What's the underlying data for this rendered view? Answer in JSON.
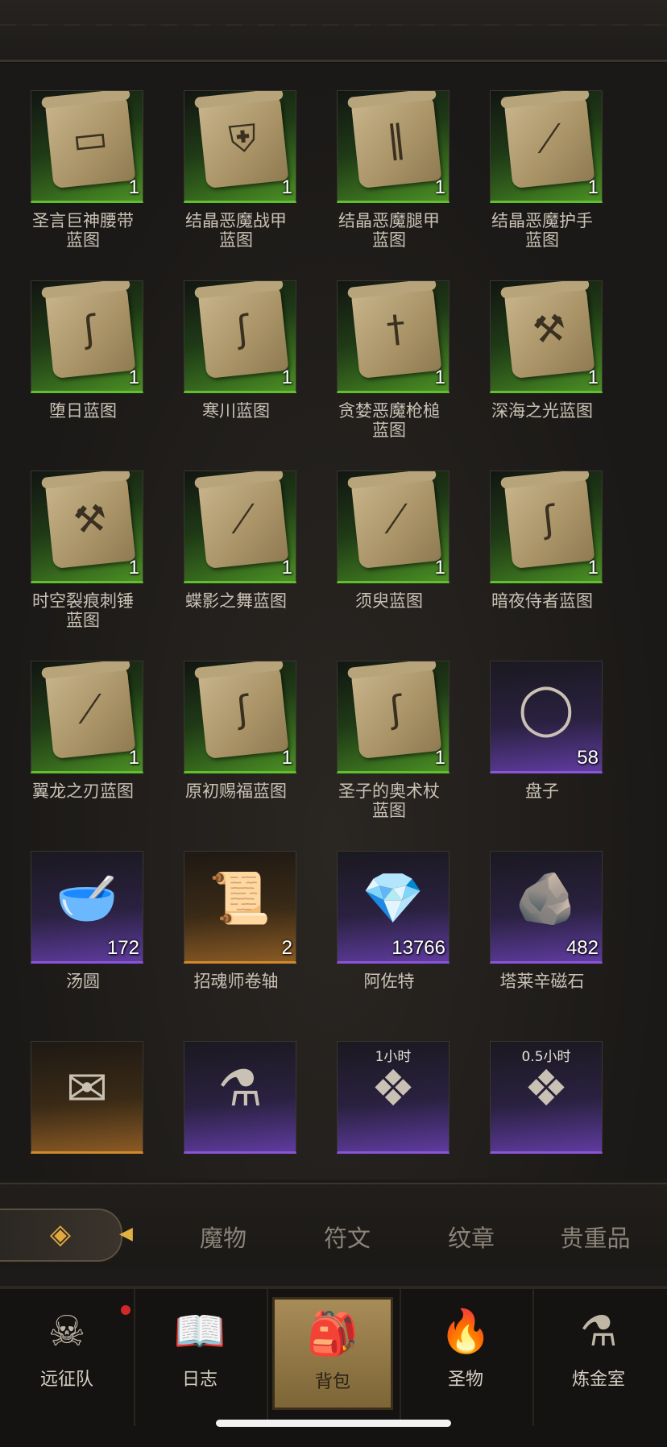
{
  "items": [
    {
      "name": "圣言巨神腰带\n蓝图",
      "count": "1",
      "rarity": "green",
      "icon": "blueprint-belt-icon",
      "glyph": "▭"
    },
    {
      "name": "结晶恶魔战甲\n蓝图",
      "count": "1",
      "rarity": "green",
      "icon": "blueprint-armor-icon",
      "glyph": "⛨"
    },
    {
      "name": "结晶恶魔腿甲\n蓝图",
      "count": "1",
      "rarity": "green",
      "icon": "blueprint-legs-icon",
      "glyph": "‖"
    },
    {
      "name": "结晶恶魔护手\n蓝图",
      "count": "1",
      "rarity": "green",
      "icon": "blueprint-gauntlet-icon",
      "glyph": "⟋"
    },
    {
      "name": "堕日蓝图",
      "count": "1",
      "rarity": "green",
      "icon": "blueprint-staff-icon",
      "glyph": "ʃ"
    },
    {
      "name": "寒川蓝图",
      "count": "1",
      "rarity": "green",
      "icon": "blueprint-staff-icon",
      "glyph": "ʃ"
    },
    {
      "name": "贪婪恶魔枪槌\n蓝图",
      "count": "1",
      "rarity": "green",
      "icon": "blueprint-spear-icon",
      "glyph": "†"
    },
    {
      "name": "深海之光蓝图",
      "count": "1",
      "rarity": "green",
      "icon": "blueprint-hammer-icon",
      "glyph": "⚒"
    },
    {
      "name": "时空裂痕刺锤\n蓝图",
      "count": "1",
      "rarity": "green",
      "icon": "blueprint-hammer-icon",
      "glyph": "⚒"
    },
    {
      "name": "蝶影之舞蓝图",
      "count": "1",
      "rarity": "green",
      "icon": "blueprint-dagger-icon",
      "glyph": "⟋"
    },
    {
      "name": "须臾蓝图",
      "count": "1",
      "rarity": "green",
      "icon": "blueprint-sword-icon",
      "glyph": "⟋"
    },
    {
      "name": "暗夜侍者蓝图",
      "count": "1",
      "rarity": "green",
      "icon": "blueprint-staff-icon",
      "glyph": "ʃ"
    },
    {
      "name": "翼龙之刃蓝图",
      "count": "1",
      "rarity": "green",
      "icon": "blueprint-sword-icon",
      "glyph": "⟋"
    },
    {
      "name": "原初赐福蓝图",
      "count": "1",
      "rarity": "green",
      "icon": "blueprint-staff-icon",
      "glyph": "ʃ"
    },
    {
      "name": "圣子的奥术杖\n蓝图",
      "count": "1",
      "rarity": "green",
      "icon": "blueprint-staff-icon",
      "glyph": "ʃ"
    },
    {
      "name": "盘子",
      "count": "58",
      "rarity": "purple",
      "icon": "plate-icon",
      "glyph": "◯"
    },
    {
      "name": "汤圆",
      "count": "172",
      "rarity": "purple",
      "icon": "rice-dumplings-icon",
      "glyph": "🥣"
    },
    {
      "name": "招魂师卷轴",
      "count": "2",
      "rarity": "orange",
      "icon": "necromancer-scroll-icon",
      "glyph": "📜"
    },
    {
      "name": "阿佐特",
      "count": "13766",
      "rarity": "purple",
      "icon": "azoth-crystal-icon",
      "glyph": "💎"
    },
    {
      "name": "塔莱辛磁石",
      "count": "482",
      "rarity": "purple",
      "icon": "magnet-stone-icon",
      "glyph": "🪨"
    },
    {
      "name": "",
      "count": "",
      "rarity": "orange",
      "icon": "letter-icon",
      "glyph": "✉"
    },
    {
      "name": "",
      "count": "",
      "rarity": "purple",
      "icon": "potion-icon",
      "glyph": "⚗"
    },
    {
      "name": "",
      "count": "",
      "rarity": "purple",
      "icon": "relic-shrine-icon",
      "glyph": "❖",
      "top_label": "1小时"
    },
    {
      "name": "",
      "count": "",
      "rarity": "purple",
      "icon": "relic-shrine-icon",
      "glyph": "❖",
      "top_label": "0.5小时"
    }
  ],
  "tabs": {
    "back_glyph": "◈",
    "arrow_glyph": "◀",
    "items": [
      "魔物",
      "符文",
      "纹章",
      "贵重品"
    ]
  },
  "nav": [
    {
      "label": "远征队",
      "glyph": "☠",
      "icon": "helmet-icon",
      "active": false,
      "dot": true
    },
    {
      "label": "日志",
      "glyph": "📖",
      "icon": "journal-icon",
      "active": false
    },
    {
      "label": "背包",
      "glyph": "🎒",
      "icon": "backpack-icon",
      "active": true
    },
    {
      "label": "圣物",
      "glyph": "🔥",
      "icon": "relic-icon",
      "active": false
    },
    {
      "label": "炼金室",
      "glyph": "⚗",
      "icon": "alchemy-icon",
      "active": false
    }
  ]
}
